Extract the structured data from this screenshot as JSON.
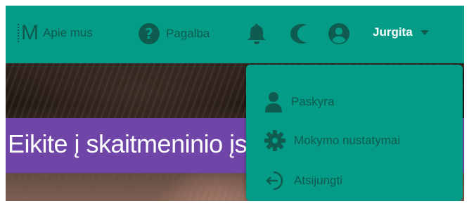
{
  "navbar": {
    "logo_letter": "M",
    "about_label": "Apie mus",
    "help_label": "Pagalba",
    "user_name": "Jurgita",
    "icons": [
      "logo-icon",
      "help-icon",
      "bell-icon",
      "moon-icon",
      "user-circle-icon",
      "caret-down-icon"
    ]
  },
  "dropdown": {
    "items": [
      {
        "label": "Paskyra",
        "icon": "user-icon"
      },
      {
        "label": "Mokymo nustatymai",
        "icon": "gear-icon"
      },
      {
        "label": "Atsijungti",
        "icon": "logout-icon"
      }
    ]
  },
  "hero": {
    "banner_text": "Eikite į skaitmeninio įsi"
  },
  "colors": {
    "navbar_bg": "#049c86",
    "icon_dark": "#0f5b50",
    "banner_purple": "#6f45a8",
    "text_white": "#ffffff"
  }
}
